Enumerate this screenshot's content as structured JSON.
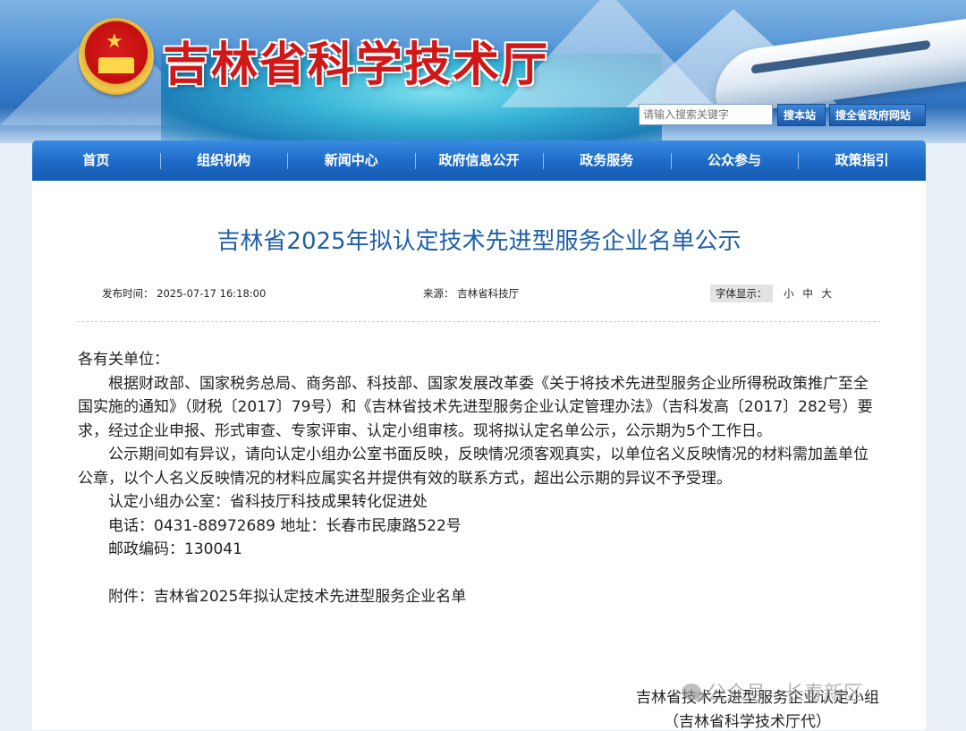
{
  "header": {
    "site_title": "吉林省科学技术厅",
    "search_placeholder": "请输入搜索关键字",
    "search_site_label": "搜本站",
    "search_gov_label": "搜全省政府网站"
  },
  "nav": {
    "items": [
      "首页",
      "组织机构",
      "新闻中心",
      "政府信息公开",
      "政务服务",
      "公众参与",
      "政策指引"
    ]
  },
  "article": {
    "title": "吉林省2025年拟认定技术先进型服务企业名单公示",
    "date": "发布时间：  2025-07-17 16:18:00",
    "source": "来源：  吉林省科技厅",
    "font_label": "字体显示：",
    "font_options": [
      "小",
      "中",
      "大"
    ],
    "salutation": "各有关单位：",
    "para1": "根据财政部、国家税务总局、商务部、科技部、国家发展改革委《关于将技术先进型服务企业所得税政策推广至全国实施的通知》（财税〔2017〕79号）和《吉林省技术先进型服务企业认定管理办法》（吉科发高〔2017〕282号）要求，经过企业申报、形式审查、专家评审、认定小组审核。现将拟认定名单公示，公示期为5个工作日。",
    "para2": "公示期间如有异议，请向认定小组办公室书面反映，反映情况须客观真实，以单位名义反映情况的材料需加盖单位公章，以个人名义反映情况的材料应属实名并提供有效的联系方式，超出公示期的异议不予受理。",
    "office": "认定小组办公室：省科技厅科技成果转化促进处",
    "phone_address": "电话：0431-88972689   地址：长春市民康路522号",
    "postcode": "邮政编码：130041",
    "attachment": "附件：吉林省2025年拟认定技术先进型服务企业名单",
    "signature_line1": "吉林省技术先进型服务企业认定小组",
    "signature_line2": "（吉林省科学技术厅代）"
  },
  "watermark": "公众号 · 长春新区"
}
